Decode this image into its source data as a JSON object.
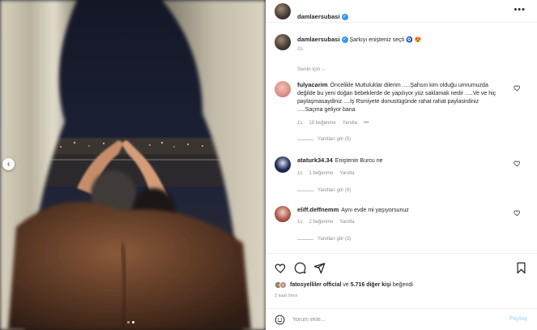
{
  "post": {
    "author": "damlaersubasi",
    "caption_user": "damlaersubasi",
    "caption_text": "Şarkıyı enişteniz seçti 🧿 😍",
    "caption_time": "2s",
    "filter_label": "Senin için ⌵"
  },
  "comments": [
    {
      "user": "fulyacarim",
      "text": "Öncelikle Mutluluklar dilerim .....Şahsın kim olduğu umrumuzda değilde bu yeni doğan bebeklerde de yapılıyor yüz saklamak nedir .....Ve ve hiç paylaşmasaydiniz ....İş Rsmiyete donustügünde rahat rahat paylasirdiniz .....Saçma geliyor bana",
      "time": "1s",
      "likes": "19 beğenme",
      "reply": "Yanıtla",
      "more": "•••",
      "replies": "Yanıtları gör (5)"
    },
    {
      "user": "ataturk34.34",
      "text": "Eniştenin Burcu ne",
      "time": "1s",
      "likes": "1 beğenme",
      "reply": "Yanıtla",
      "replies": "Yanıtları gör (9)"
    },
    {
      "user": "eliff.deffnemm",
      "text": "Aynı evde mi yaşıyorsunuz",
      "time": "1s",
      "likes": "2 beğenme",
      "reply": "Yanıtla",
      "replies": "Yanıtları gör (3)"
    }
  ],
  "likes": {
    "first_user": "fatosyelliler official",
    "connector": "ve",
    "others": "5.716 diğer kişi",
    "suffix": "beğendi"
  },
  "posted_ago": "2 saat önce",
  "add_comment": {
    "placeholder": "Yorum ekle...",
    "post_label": "Paylaş"
  },
  "colors": {
    "verified": "#3897f0",
    "muted": "#8e8e8e",
    "post_button_disabled": "#b2dffc"
  },
  "icons": [
    "more-icon",
    "heart-icon",
    "comment-icon",
    "share-icon",
    "bookmark-icon",
    "emoji-icon",
    "chevron-left-icon",
    "verified-icon"
  ],
  "carousel": {
    "current": 1,
    "total": 2
  }
}
